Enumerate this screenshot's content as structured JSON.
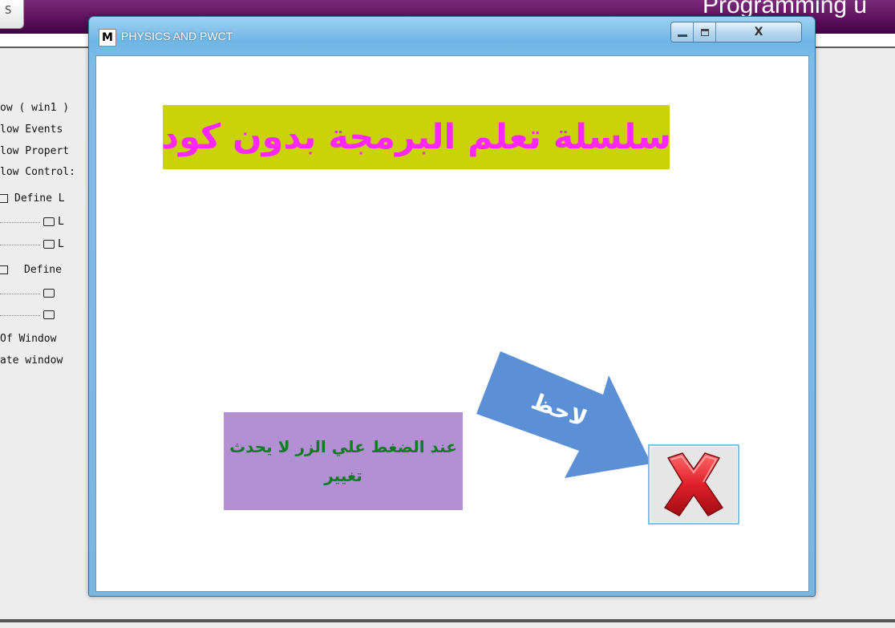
{
  "background_app": {
    "tab_fragment": "S",
    "title_fragment": "Programming u",
    "tree_rows": [
      {
        "text": "ow  ( win1 )"
      },
      {
        "text": "low Events"
      },
      {
        "text": "low Propert"
      },
      {
        "text": "low Control:"
      },
      {
        "text": "Define L"
      },
      {
        "text": "L"
      },
      {
        "text": "L"
      },
      {
        "text": "Define"
      },
      {
        "text": ""
      },
      {
        "text": ""
      },
      {
        "text": " Of Window"
      },
      {
        "text": "ate window"
      }
    ]
  },
  "window": {
    "icon_letter": "M",
    "title": "PHYSICS AND PWCT",
    "close_glyph": "X"
  },
  "content": {
    "banner_text": "سلسلة تعلم البرمجة بدون كود",
    "note_text": "عند الضغط علي الزر لا يحدث تغيير",
    "arrow_text": "لاحظ"
  },
  "colors": {
    "banner_bg": "#cbd20a",
    "banner_text": "#ff26ff",
    "note_bg": "#b38fd4",
    "note_text": "#127a25",
    "arrow_fill": "#5b8fd6",
    "close_x": "#e1202a"
  },
  "icons": {
    "close_image": "red-x-icon"
  }
}
